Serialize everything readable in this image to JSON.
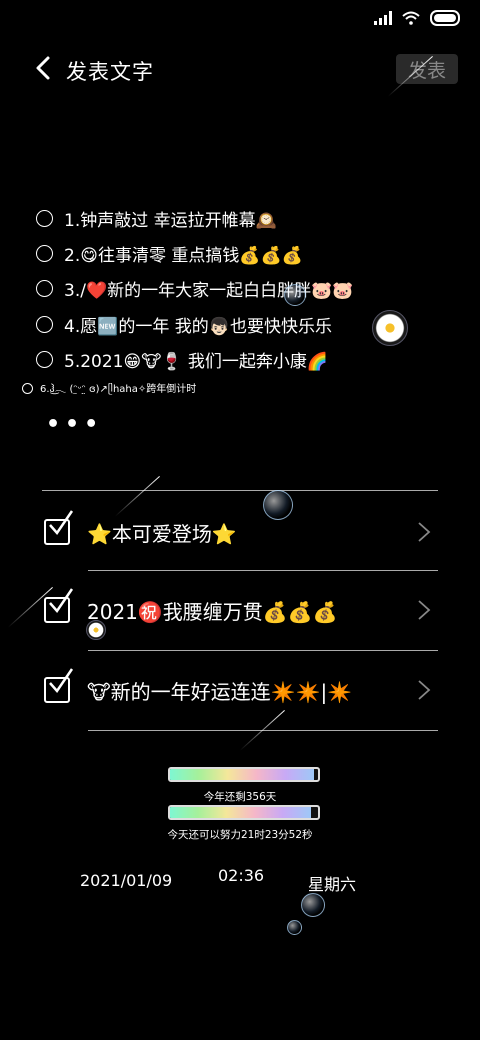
{
  "header": {
    "title": "发表文字",
    "publish_label": "发表"
  },
  "items": [
    "1.钟声敲过 幸运拉开帷幕🕰️",
    "2.😋往事清零 重点搞钱💰💰💰",
    "3./❤️新的一年大家一起白白胖胖🐷🐷",
    "4.愿🆕的一年 我的👦🏻也要快快乐乐",
    "5.2021😁🐮🍷 我们一起奔小康🌈",
    "6.ჰ͜𓂃 (ᵔ̤ᵕᵔ̤ ɞ)↗ᥫhaha✧跨年倒计时"
  ],
  "more_label": "•••",
  "checks": [
    "⭐本可爱登场⭐",
    "2021㊗️我腰缠万贯💰💰💰",
    "🐮新的一年好运连连✴️✴️|✴️"
  ],
  "progress": {
    "year_fraction": 0.97,
    "day_fraction": 0.95,
    "year_text": "今年还剩356天",
    "day_text": "今天还可以努力21时23分52秒"
  },
  "footer": {
    "date": "2021/01/09",
    "time": "02:36",
    "weekday": "星期六"
  }
}
